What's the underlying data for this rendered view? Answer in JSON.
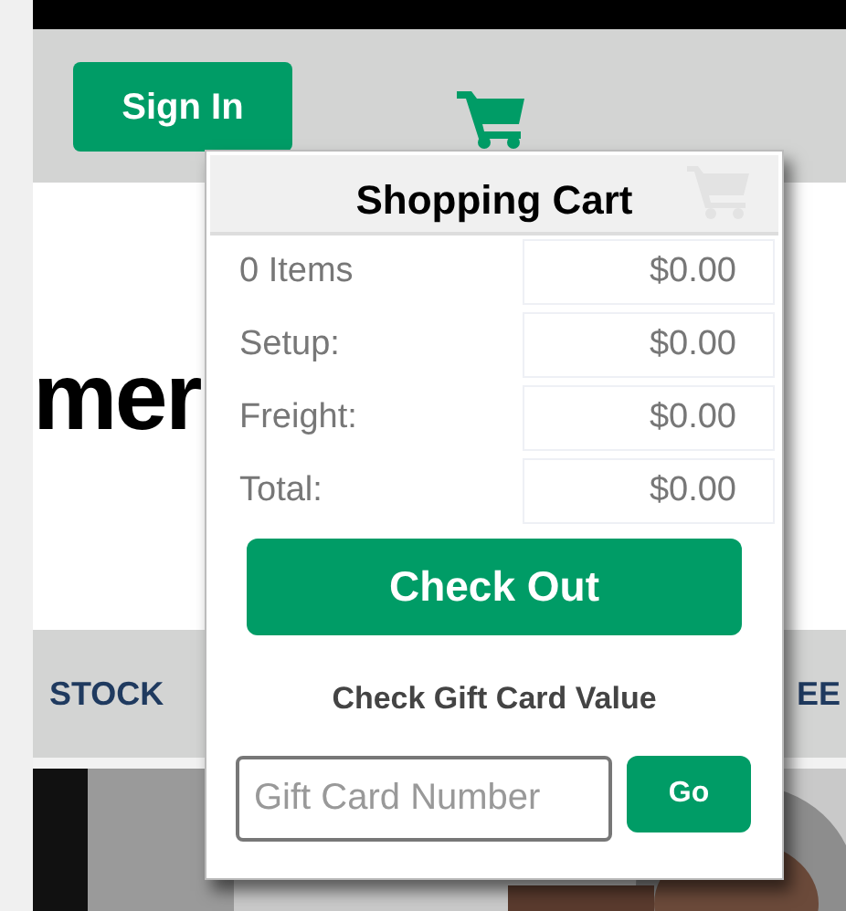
{
  "header": {
    "sign_in": "Sign In"
  },
  "banner": {
    "text": "mer"
  },
  "nav": {
    "items": [
      "STOCK",
      "EE"
    ]
  },
  "cart_popup": {
    "title": "Shopping Cart",
    "rows": [
      {
        "label": "0 Items",
        "value": "$0.00"
      },
      {
        "label": "Setup:",
        "value": "$0.00"
      },
      {
        "label": "Freight:",
        "value": "$0.00"
      },
      {
        "label": "Total:",
        "value": "$0.00"
      }
    ],
    "checkout": "Check Out",
    "gift_title": "Check Gift Card Value",
    "gift_field": {
      "placeholder": "Gift Card Number"
    },
    "go": "Go"
  }
}
